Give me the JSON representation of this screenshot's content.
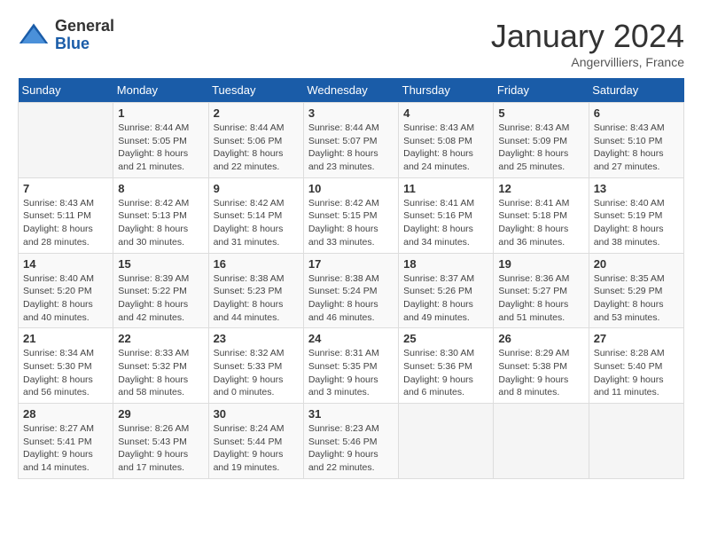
{
  "header": {
    "logo_general": "General",
    "logo_blue": "Blue",
    "title": "January 2024",
    "location": "Angervilliers, France"
  },
  "days_of_week": [
    "Sunday",
    "Monday",
    "Tuesday",
    "Wednesday",
    "Thursday",
    "Friday",
    "Saturday"
  ],
  "weeks": [
    [
      {
        "day": "",
        "info": ""
      },
      {
        "day": "1",
        "info": "Sunrise: 8:44 AM\nSunset: 5:05 PM\nDaylight: 8 hours\nand 21 minutes."
      },
      {
        "day": "2",
        "info": "Sunrise: 8:44 AM\nSunset: 5:06 PM\nDaylight: 8 hours\nand 22 minutes."
      },
      {
        "day": "3",
        "info": "Sunrise: 8:44 AM\nSunset: 5:07 PM\nDaylight: 8 hours\nand 23 minutes."
      },
      {
        "day": "4",
        "info": "Sunrise: 8:43 AM\nSunset: 5:08 PM\nDaylight: 8 hours\nand 24 minutes."
      },
      {
        "day": "5",
        "info": "Sunrise: 8:43 AM\nSunset: 5:09 PM\nDaylight: 8 hours\nand 25 minutes."
      },
      {
        "day": "6",
        "info": "Sunrise: 8:43 AM\nSunset: 5:10 PM\nDaylight: 8 hours\nand 27 minutes."
      }
    ],
    [
      {
        "day": "7",
        "info": "Sunrise: 8:43 AM\nSunset: 5:11 PM\nDaylight: 8 hours\nand 28 minutes."
      },
      {
        "day": "8",
        "info": "Sunrise: 8:42 AM\nSunset: 5:13 PM\nDaylight: 8 hours\nand 30 minutes."
      },
      {
        "day": "9",
        "info": "Sunrise: 8:42 AM\nSunset: 5:14 PM\nDaylight: 8 hours\nand 31 minutes."
      },
      {
        "day": "10",
        "info": "Sunrise: 8:42 AM\nSunset: 5:15 PM\nDaylight: 8 hours\nand 33 minutes."
      },
      {
        "day": "11",
        "info": "Sunrise: 8:41 AM\nSunset: 5:16 PM\nDaylight: 8 hours\nand 34 minutes."
      },
      {
        "day": "12",
        "info": "Sunrise: 8:41 AM\nSunset: 5:18 PM\nDaylight: 8 hours\nand 36 minutes."
      },
      {
        "day": "13",
        "info": "Sunrise: 8:40 AM\nSunset: 5:19 PM\nDaylight: 8 hours\nand 38 minutes."
      }
    ],
    [
      {
        "day": "14",
        "info": "Sunrise: 8:40 AM\nSunset: 5:20 PM\nDaylight: 8 hours\nand 40 minutes."
      },
      {
        "day": "15",
        "info": "Sunrise: 8:39 AM\nSunset: 5:22 PM\nDaylight: 8 hours\nand 42 minutes."
      },
      {
        "day": "16",
        "info": "Sunrise: 8:38 AM\nSunset: 5:23 PM\nDaylight: 8 hours\nand 44 minutes."
      },
      {
        "day": "17",
        "info": "Sunrise: 8:38 AM\nSunset: 5:24 PM\nDaylight: 8 hours\nand 46 minutes."
      },
      {
        "day": "18",
        "info": "Sunrise: 8:37 AM\nSunset: 5:26 PM\nDaylight: 8 hours\nand 49 minutes."
      },
      {
        "day": "19",
        "info": "Sunrise: 8:36 AM\nSunset: 5:27 PM\nDaylight: 8 hours\nand 51 minutes."
      },
      {
        "day": "20",
        "info": "Sunrise: 8:35 AM\nSunset: 5:29 PM\nDaylight: 8 hours\nand 53 minutes."
      }
    ],
    [
      {
        "day": "21",
        "info": "Sunrise: 8:34 AM\nSunset: 5:30 PM\nDaylight: 8 hours\nand 56 minutes."
      },
      {
        "day": "22",
        "info": "Sunrise: 8:33 AM\nSunset: 5:32 PM\nDaylight: 8 hours\nand 58 minutes."
      },
      {
        "day": "23",
        "info": "Sunrise: 8:32 AM\nSunset: 5:33 PM\nDaylight: 9 hours\nand 0 minutes."
      },
      {
        "day": "24",
        "info": "Sunrise: 8:31 AM\nSunset: 5:35 PM\nDaylight: 9 hours\nand 3 minutes."
      },
      {
        "day": "25",
        "info": "Sunrise: 8:30 AM\nSunset: 5:36 PM\nDaylight: 9 hours\nand 6 minutes."
      },
      {
        "day": "26",
        "info": "Sunrise: 8:29 AM\nSunset: 5:38 PM\nDaylight: 9 hours\nand 8 minutes."
      },
      {
        "day": "27",
        "info": "Sunrise: 8:28 AM\nSunset: 5:40 PM\nDaylight: 9 hours\nand 11 minutes."
      }
    ],
    [
      {
        "day": "28",
        "info": "Sunrise: 8:27 AM\nSunset: 5:41 PM\nDaylight: 9 hours\nand 14 minutes."
      },
      {
        "day": "29",
        "info": "Sunrise: 8:26 AM\nSunset: 5:43 PM\nDaylight: 9 hours\nand 17 minutes."
      },
      {
        "day": "30",
        "info": "Sunrise: 8:24 AM\nSunset: 5:44 PM\nDaylight: 9 hours\nand 19 minutes."
      },
      {
        "day": "31",
        "info": "Sunrise: 8:23 AM\nSunset: 5:46 PM\nDaylight: 9 hours\nand 22 minutes."
      },
      {
        "day": "",
        "info": ""
      },
      {
        "day": "",
        "info": ""
      },
      {
        "day": "",
        "info": ""
      }
    ]
  ]
}
